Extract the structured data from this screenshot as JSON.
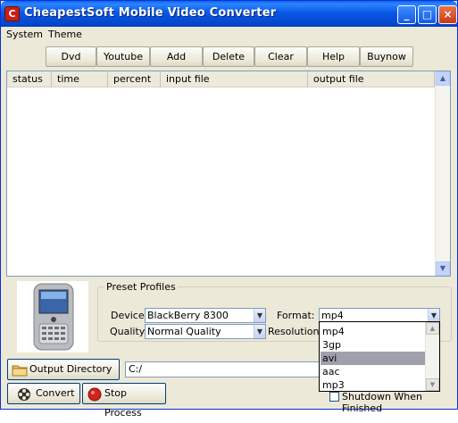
{
  "window": {
    "title": "CheapestSoft Mobile Video Converter",
    "icon_glyph": "C",
    "controls": {
      "minimize": "_",
      "maximize": "□",
      "close": "×"
    }
  },
  "menu": [
    {
      "label": "System"
    },
    {
      "label": "Theme"
    }
  ],
  "toolbar": [
    {
      "label": "Dvd"
    },
    {
      "label": "Youtube"
    },
    {
      "label": "Add"
    },
    {
      "label": "Delete"
    },
    {
      "label": "Clear"
    },
    {
      "label": "Help"
    },
    {
      "label": "Buynow"
    }
  ],
  "list": {
    "columns": [
      "status",
      "time",
      "percent",
      "input file",
      "output file"
    ],
    "rows": []
  },
  "preset": {
    "legend": "Preset Profiles",
    "device_label": "Device:",
    "device_value": "BlackBerry 8300",
    "quality_label": "Quality:",
    "quality_value": "Normal Quality",
    "format_label": "Format:",
    "format_value": "mp4",
    "resolution_label": "Resolution :"
  },
  "format_dropdown": {
    "options": [
      "mp4",
      "3gp",
      "avi",
      "aac",
      "mp3"
    ],
    "highlighted": "avi"
  },
  "output": {
    "button_label": "Output Directory ...",
    "path": "C:/"
  },
  "actions": {
    "convert": "Convert",
    "stop": "Stop Process",
    "shutdown": "Shutdown When Finished"
  },
  "colors": {
    "titlebar": "#0a57e6",
    "window_bg": "#ece9d8",
    "stop_icon": "#d0231e"
  }
}
